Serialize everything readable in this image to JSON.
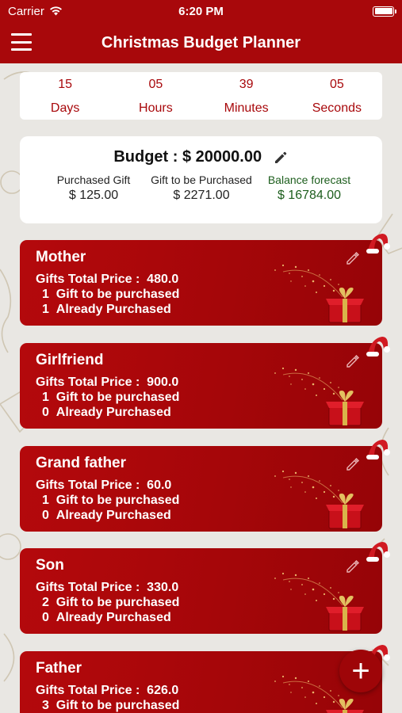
{
  "status": {
    "carrier": "Carrier",
    "time": "6:20 PM"
  },
  "nav": {
    "title": "Christmas Budget Planner"
  },
  "countdown": {
    "days": "15",
    "days_label": "Days",
    "hours": "05",
    "hours_label": "Hours",
    "minutes": "39",
    "minutes_label": "Minutes",
    "seconds": "05",
    "seconds_label": "Seconds"
  },
  "budget": {
    "label": "Budget :",
    "amount": "$ 20000.00",
    "purchased_label": "Purchased Gift",
    "purchased_value": "$ 125.00",
    "to_be_purchased_label": "Gift to be Purchased",
    "to_be_purchased_value": "$ 2271.00",
    "balance_label": "Balance forecast",
    "balance_value": "$ 16784.00"
  },
  "people": [
    {
      "name": "Mother",
      "total_label": "Gifts Total Price :",
      "total": "480.0",
      "to_buy_count": "1",
      "to_buy_label": "Gift to be purchased",
      "bought_count": "1",
      "bought_label": "Already Purchased"
    },
    {
      "name": "Girlfriend",
      "total_label": "Gifts Total Price :",
      "total": "900.0",
      "to_buy_count": "1",
      "to_buy_label": "Gift to be purchased",
      "bought_count": "0",
      "bought_label": "Already Purchased"
    },
    {
      "name": "Grand father",
      "total_label": "Gifts Total Price :",
      "total": "60.0",
      "to_buy_count": "1",
      "to_buy_label": "Gift to be purchased",
      "bought_count": "0",
      "bought_label": "Already Purchased"
    },
    {
      "name": "Son",
      "total_label": "Gifts Total Price :",
      "total": "330.0",
      "to_buy_count": "2",
      "to_buy_label": "Gift to be purchased",
      "bought_count": "0",
      "bought_label": "Already Purchased"
    },
    {
      "name": "Father",
      "total_label": "Gifts Total Price :",
      "total": "626.0",
      "to_buy_count": "3",
      "to_buy_label": "Gift to be purchased",
      "bought_count": "",
      "bought_label": ""
    }
  ],
  "fab": {
    "label": "+"
  },
  "colors": {
    "primary": "#a8080b",
    "balance": "#1d5e1d"
  },
  "icons": {
    "menu": "hamburger-menu-icon",
    "edit": "pencil-icon",
    "gift": "gift-box-icon",
    "hat": "santa-hat-icon",
    "add": "plus-icon"
  }
}
